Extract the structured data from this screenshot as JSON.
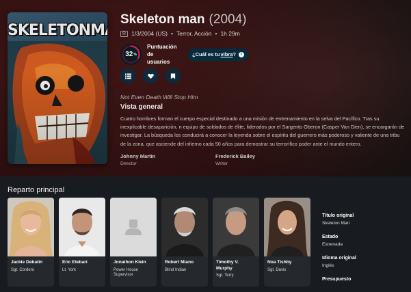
{
  "movie": {
    "title": "Skeleton man",
    "year": "(2004)",
    "certification": "R",
    "release": "1/3/2004 (US)",
    "genres": "Terror, Acción",
    "runtime": "1h 29m",
    "poster_logo": "SKELETONMAN"
  },
  "score": {
    "value": "32",
    "percent_sign": "%",
    "percent": 32,
    "label": "Puntuación de usuarios",
    "ring_color": "#db2360",
    "track_color": "#571435"
  },
  "vibe": {
    "prefix": "¿Cuál es tu ",
    "link": "vibra",
    "suffix": "?"
  },
  "actions": [
    "list-icon",
    "heart-icon",
    "bookmark-icon"
  ],
  "tagline": "Not Even Death Will Stop Him",
  "overview_heading": "Vista general",
  "overview": "Cuatro hombres forman el cuerpo especial destinado a una misión de entrenamiento en la selva del Pacífico. Tras su inexplicable desaparición, n equipo de soldados de élite, liderados por el Sargento Oberon (Casper Van Dien), se encargarán de investigar. La búsqueda los conducirá a conocer la leyenda sobre el espíritu del guerrero más poderoso y valiente de una tribu de la zona, que asciende del infierno cada 50 años para demostrar su terrorífico poder ante el mundo entero.",
  "crew": [
    {
      "name": "Johnny Martin",
      "role": "Director"
    },
    {
      "name": "Frederick Bailey",
      "role": "Writer"
    }
  ],
  "cast_heading": "Reparto principal",
  "cast": [
    {
      "name": "Jackie Debatin",
      "role": "Sgt. Cordero"
    },
    {
      "name": "Eric Etebari",
      "role": "Lt. York"
    },
    {
      "name": "Jonathon Klein",
      "role": "Power House Supervisor"
    },
    {
      "name": "Robert Miano",
      "role": "Blind Indian"
    },
    {
      "name": "Timothy V. Murphy",
      "role": "Sgt. Terry"
    },
    {
      "name": "Noa Tishby",
      "role": "Sgt. Davis"
    }
  ],
  "facts": [
    {
      "label": "Título original",
      "value": "Skeleton Man"
    },
    {
      "label": "Estado",
      "value": "Estrenada"
    },
    {
      "label": "Idioma original",
      "value": "Inglés"
    },
    {
      "label": "Presupuesto",
      "value": ""
    }
  ]
}
